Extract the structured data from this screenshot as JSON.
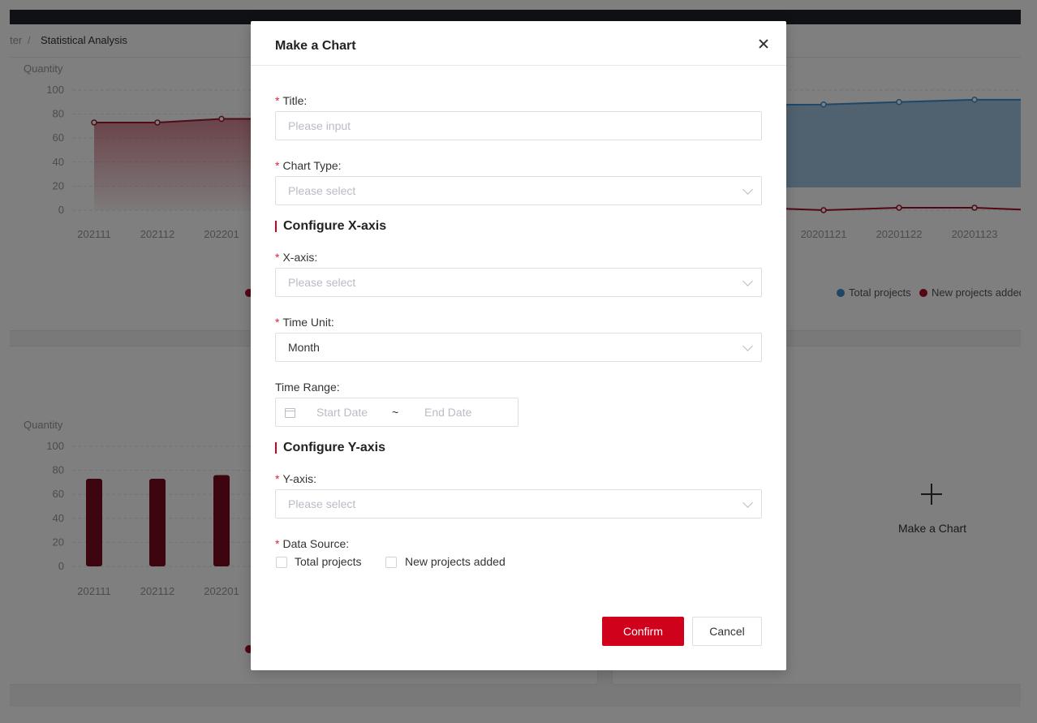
{
  "breadcrumb": {
    "parent": "ter",
    "separator": "/",
    "current": "Statistical Analysis"
  },
  "charts": {
    "top_left": {
      "ylabel": "Quantity",
      "yticks": [
        "100",
        "80",
        "60",
        "40",
        "20",
        "0"
      ],
      "xticks": [
        "202111",
        "202112",
        "202201"
      ]
    },
    "top_right": {
      "xticks": [
        "20201121",
        "20201122",
        "20201123"
      ],
      "legend": [
        "Total projects",
        "New projects added"
      ]
    },
    "bottom_left": {
      "ylabel": "Quantity",
      "yticks": [
        "100",
        "80",
        "60",
        "40",
        "20",
        "0"
      ],
      "xticks": [
        "202111",
        "202112",
        "202201"
      ]
    }
  },
  "chart_data": [
    {
      "type": "area",
      "xlabel": "",
      "ylabel": "Quantity",
      "ylim": [
        0,
        100
      ],
      "categories": [
        "202111",
        "202112",
        "202201"
      ],
      "series": [
        {
          "name": "",
          "values": [
            73,
            73,
            76
          ],
          "color": "#9b1b30"
        }
      ]
    },
    {
      "type": "line",
      "xlabel": "",
      "ylabel": "",
      "categories": [
        "20201121",
        "20201122",
        "20201123"
      ],
      "series": [
        {
          "name": "Total projects",
          "values": [
            88,
            90,
            92
          ],
          "color": "#3a8fd3"
        },
        {
          "name": "New projects added",
          "values": [
            0,
            1,
            1
          ],
          "color": "#a80d2a"
        }
      ]
    },
    {
      "type": "bar",
      "xlabel": "",
      "ylabel": "Quantity",
      "ylim": [
        0,
        100
      ],
      "categories": [
        "202111",
        "202112",
        "202201"
      ],
      "values": [
        73,
        73,
        76
      ],
      "color": "#7a0a1e"
    }
  ],
  "add_chart_card": {
    "label": "Make a Chart",
    "icon": "plus-icon"
  },
  "modal": {
    "title": "Make a Chart",
    "close_icon": "close-icon",
    "fields": {
      "title": {
        "label": "Title:",
        "placeholder": "Please input",
        "required": true
      },
      "chart_type": {
        "label": "Chart Type:",
        "placeholder": "Please select",
        "required": true
      },
      "x_axis": {
        "label": "X-axis:",
        "placeholder": "Please select",
        "required": true
      },
      "time_unit": {
        "label": "Time Unit:",
        "value": "Month",
        "required": true
      },
      "time_range": {
        "label": "Time Range:",
        "start_placeholder": "Start Date",
        "separator": "~",
        "end_placeholder": "End Date"
      },
      "y_axis": {
        "label": "Y-axis:",
        "placeholder": "Please select",
        "required": true
      },
      "data_source": {
        "label": "Data Source:",
        "options": [
          "Total projects",
          "New projects added"
        ],
        "required": true
      }
    },
    "sections": {
      "x": "Configure X-axis",
      "y": "Configure Y-axis"
    },
    "buttons": {
      "confirm": "Confirm",
      "cancel": "Cancel"
    },
    "required_mark": "*"
  },
  "colors": {
    "accent": "#d0021b",
    "line_blue": "#3a8fd3",
    "line_red": "#a80d2a"
  }
}
